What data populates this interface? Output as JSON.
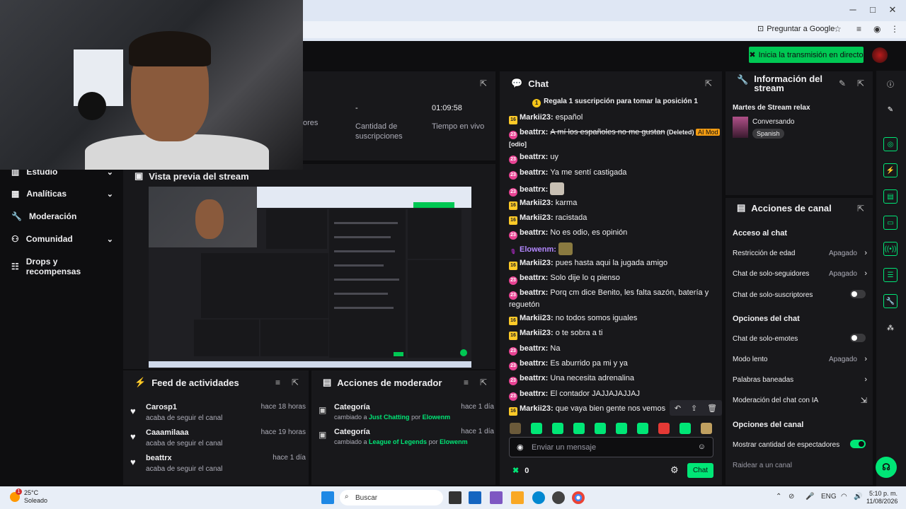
{
  "browser": {
    "ask_google": "Preguntar a Google",
    "window_controls": [
      "─",
      "□",
      "✕"
    ]
  },
  "topbar": {
    "go_live": "Inicia la transmisión en directo"
  },
  "nav": {
    "items": [
      {
        "label": "Estudio",
        "icon": "studio-icon",
        "has_chevron": true
      },
      {
        "label": "Analíticas",
        "icon": "analytics-icon",
        "has_chevron": true
      },
      {
        "label": "Moderación",
        "icon": "wrench-icon",
        "has_chevron": false
      },
      {
        "label": "Comunidad",
        "icon": "community-icon",
        "has_chevron": true
      },
      {
        "label": "Drops y recompensas",
        "icon": "drops-icon",
        "has_chevron": false
      }
    ]
  },
  "stats": {
    "followers_label_partial": "ores",
    "subs_value": "-",
    "subs_label": "Cantidad de suscripciones",
    "live_value": "01:09:58",
    "live_label": "Tiempo en vivo"
  },
  "preview": {
    "title": "Vista previa del stream"
  },
  "activity_feed": {
    "title": "Feed de actividades",
    "items": [
      {
        "name": "Carosp1",
        "desc": "acaba de seguir el canal",
        "time": "hace 18 horas"
      },
      {
        "name": "Caaamilaaa",
        "desc": "acaba de seguir el canal",
        "time": "hace 19 horas"
      },
      {
        "name": "beattrx",
        "desc": "acaba de seguir el canal",
        "time": "hace 1 día"
      }
    ]
  },
  "mod_actions": {
    "title": "Acciones de moderador",
    "items": [
      {
        "title": "Categoría",
        "prefix": "cambiado a",
        "target": "Just Chatting",
        "by": "por",
        "user": "Elowenm",
        "time": "hace 1 día"
      },
      {
        "title": "Categoría",
        "prefix": "cambiado a",
        "target": "League of Legends",
        "by": "por",
        "user": "Elowenm",
        "time": "hace 1 día"
      }
    ]
  },
  "chat": {
    "title": "Chat",
    "pinned": "Regala 1 suscripción para tomar la posición 1",
    "pinned_rank": "1",
    "messages": [
      {
        "badge": "16",
        "user": "Markii23",
        "text": "español"
      },
      {
        "badge": "23",
        "user": "beattrx",
        "text": "A mí los españoles no me gustan",
        "deleted": "(Deleted)",
        "aimod": "AI Mod",
        "tag": "[odio]"
      },
      {
        "badge": "23",
        "user": "beattrx",
        "text": "uy"
      },
      {
        "badge": "23",
        "user": "beattrx",
        "text": "Ya me sentí castigada"
      },
      {
        "badge": "23",
        "user": "beattrx",
        "text": "",
        "emote": "#c8c0b4"
      },
      {
        "badge": "16",
        "user": "Markii23",
        "text": "karma"
      },
      {
        "badge": "16",
        "user": "Markii23",
        "text": "racistada"
      },
      {
        "badge": "23",
        "user": "beattrx",
        "text": "No es odio, es opinión"
      },
      {
        "badge": "mic",
        "user": "Elowenm",
        "text": "",
        "emote": "#8a7a40",
        "usercolor": "#b388ff"
      },
      {
        "badge": "16",
        "user": "Markii23",
        "text": "pues hasta aqui la jugada amigo"
      },
      {
        "badge": "23",
        "user": "beattrx",
        "text": "Solo dije lo q pienso"
      },
      {
        "badge": "23",
        "user": "beattrx",
        "text": "Porq cm dice Benito, les falta sazón, batería y reguetón"
      },
      {
        "badge": "16",
        "user": "Markii23",
        "text": "no todos somos iguales"
      },
      {
        "badge": "16",
        "user": "Markii23",
        "text": "o te sobra a ti"
      },
      {
        "badge": "23",
        "user": "beattrx",
        "text": "Na"
      },
      {
        "badge": "23",
        "user": "beattrx",
        "text": "Es aburrido pa mi y ya"
      },
      {
        "badge": "23",
        "user": "beattrx",
        "text": "Una necesita adrenalina"
      },
      {
        "badge": "23",
        "user": "beattrx",
        "text": "El contador JAJJAJAJJAJ"
      },
      {
        "badge": "16",
        "user": "Markii23",
        "text": "que vaya bien gente nos vemos"
      }
    ],
    "input_placeholder": "Enviar un mensaje",
    "points": "0",
    "send_label": "Chat",
    "emote_colors": [
      "#6b5a3a",
      "#00e676",
      "#00e676",
      "#00e676",
      "#00e676",
      "#00e676",
      "#00e676",
      "#e53935",
      "#00e676",
      "#c0a060"
    ]
  },
  "stream_info": {
    "title": "Información del stream",
    "stream_title": "Martes de Stream relax",
    "category": "Conversando",
    "language": "Spanish"
  },
  "channel_actions": {
    "title": "Acciones de canal",
    "chat_access": "Acceso al chat",
    "age_restriction": "Restricción de edad",
    "age_restriction_val": "Apagado",
    "followers_only": "Chat de solo-seguidores",
    "followers_only_val": "Apagado",
    "subs_only": "Chat de solo-suscriptores",
    "chat_options": "Opciones del chat",
    "emotes_only": "Chat de solo-emotes",
    "slow_mode": "Modo lento",
    "slow_mode_val": "Apagado",
    "banned_words": "Palabras baneadas",
    "ai_moderation": "Moderación del chat con IA",
    "channel_options": "Opciones del canal",
    "show_viewers": "Mostrar cantidad de espectadores",
    "raid": "Raidear a un canal"
  },
  "taskbar": {
    "temp": "25°C",
    "weather": "Soleado",
    "search": "Buscar",
    "lang": "ENG",
    "time": "5:10 p. m.",
    "date": "11/08/2026",
    "notif_count": "1"
  }
}
